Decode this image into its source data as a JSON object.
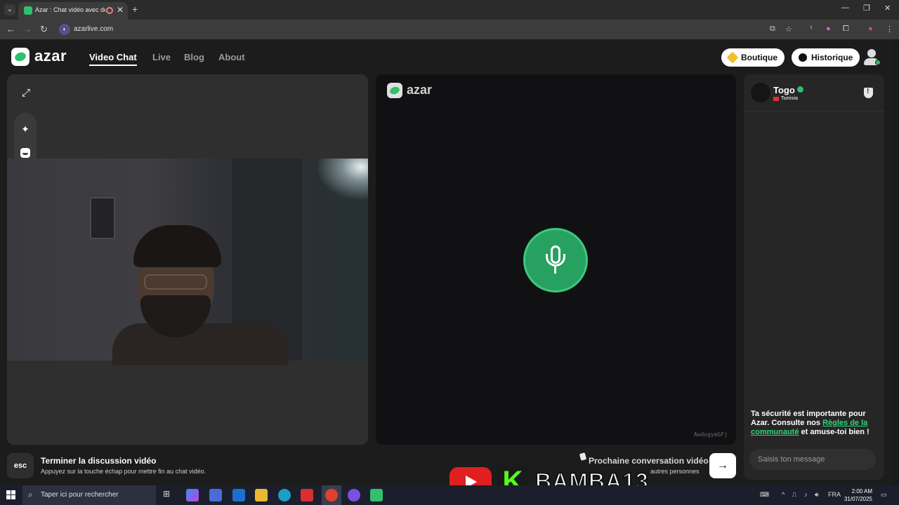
{
  "browser": {
    "tab_title": "Azar : Chat vidéo avec de n",
    "url": "azarlive.com",
    "new_tab": "+",
    "close": "✕",
    "window": {
      "min": "—",
      "max": "❐",
      "close": "✕"
    }
  },
  "header": {
    "logo_text": "azar",
    "nav": [
      "Video Chat",
      "Live",
      "Blog",
      "About"
    ],
    "boutique_label": "Boutique",
    "historique_label": "Historique"
  },
  "center": {
    "watermark": "azar",
    "user_id": "AwdugyeGFj"
  },
  "chat": {
    "peer_name": "Togo",
    "peer_country": "Tunisia",
    "safety_prefix": "Ta sécurité est importante pour Azar. Consulte nos ",
    "safety_link": "Règles de la communauté",
    "safety_suffix": " et amuse-toi bien !",
    "message_placeholder": "Saisis ton message"
  },
  "bottom": {
    "esc_key": "esc",
    "end_title": "Terminer la discussion vidéo",
    "end_hint": "Appuyez sur la touche échap pour mettre fin au chat vidéo.",
    "next_title": "Prochaine conversation vidéo",
    "next_hint": "autres personnes",
    "next_arrow": "→"
  },
  "overlay": {
    "kick_letter": "K",
    "streamer_name": "BAMBA13"
  },
  "taskbar": {
    "search_placeholder": "Taper ici pour rechercher",
    "language": "FRA",
    "time": "2:00 AM",
    "date": "31/07/2025"
  },
  "colors": {
    "brand_green": "#2fbf6f",
    "link_green": "#2fd67c",
    "mic_green": "#27a160"
  }
}
